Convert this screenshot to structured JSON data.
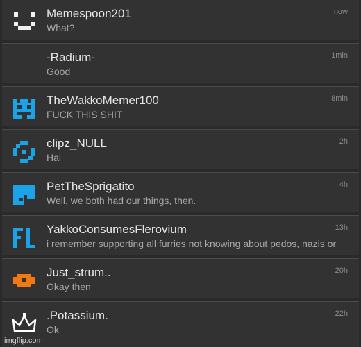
{
  "conversations": [
    {
      "name": "Memespoon201",
      "message": "What?",
      "time": "now",
      "avatar": "white-pixel-face-icon",
      "color": "#f0f0f0"
    },
    {
      "name": "-Radium-",
      "message": "Good",
      "time": "1min",
      "avatar": "none",
      "color": ""
    },
    {
      "name": "TheWakkoMemer100",
      "message": "FUCK THIS SHIT",
      "time": "8min",
      "avatar": "blue-pixel-face-icon",
      "color": "#1aa3e8"
    },
    {
      "name": "clipz_NULL",
      "message": "Hai",
      "time": "2h",
      "avatar": "blue-pixel-ring-icon",
      "color": "#1aa3e8"
    },
    {
      "name": "PetTheSprigatito",
      "message": "Well, we both had our things, then.",
      "time": "4h",
      "avatar": "blue-pixel-block-icon",
      "color": "#1aa3e8"
    },
    {
      "name": "YakkoConsumesFlerovium",
      "message": "i remember supporting all furries not knowing about pedos, nazis or",
      "time": "13h",
      "avatar": "blue-fl-letters-icon",
      "color": "#1aa3e8"
    },
    {
      "name": "Just_strum..",
      "message": "Okay then",
      "time": "20h",
      "avatar": "orange-pixel-icon",
      "color": "#f07a10"
    },
    {
      "name": ".Potassium.",
      "message": "Ok",
      "time": "22h",
      "avatar": "crown-icon",
      "color": "#ffffff"
    }
  ],
  "watermark": "imgflip.com"
}
